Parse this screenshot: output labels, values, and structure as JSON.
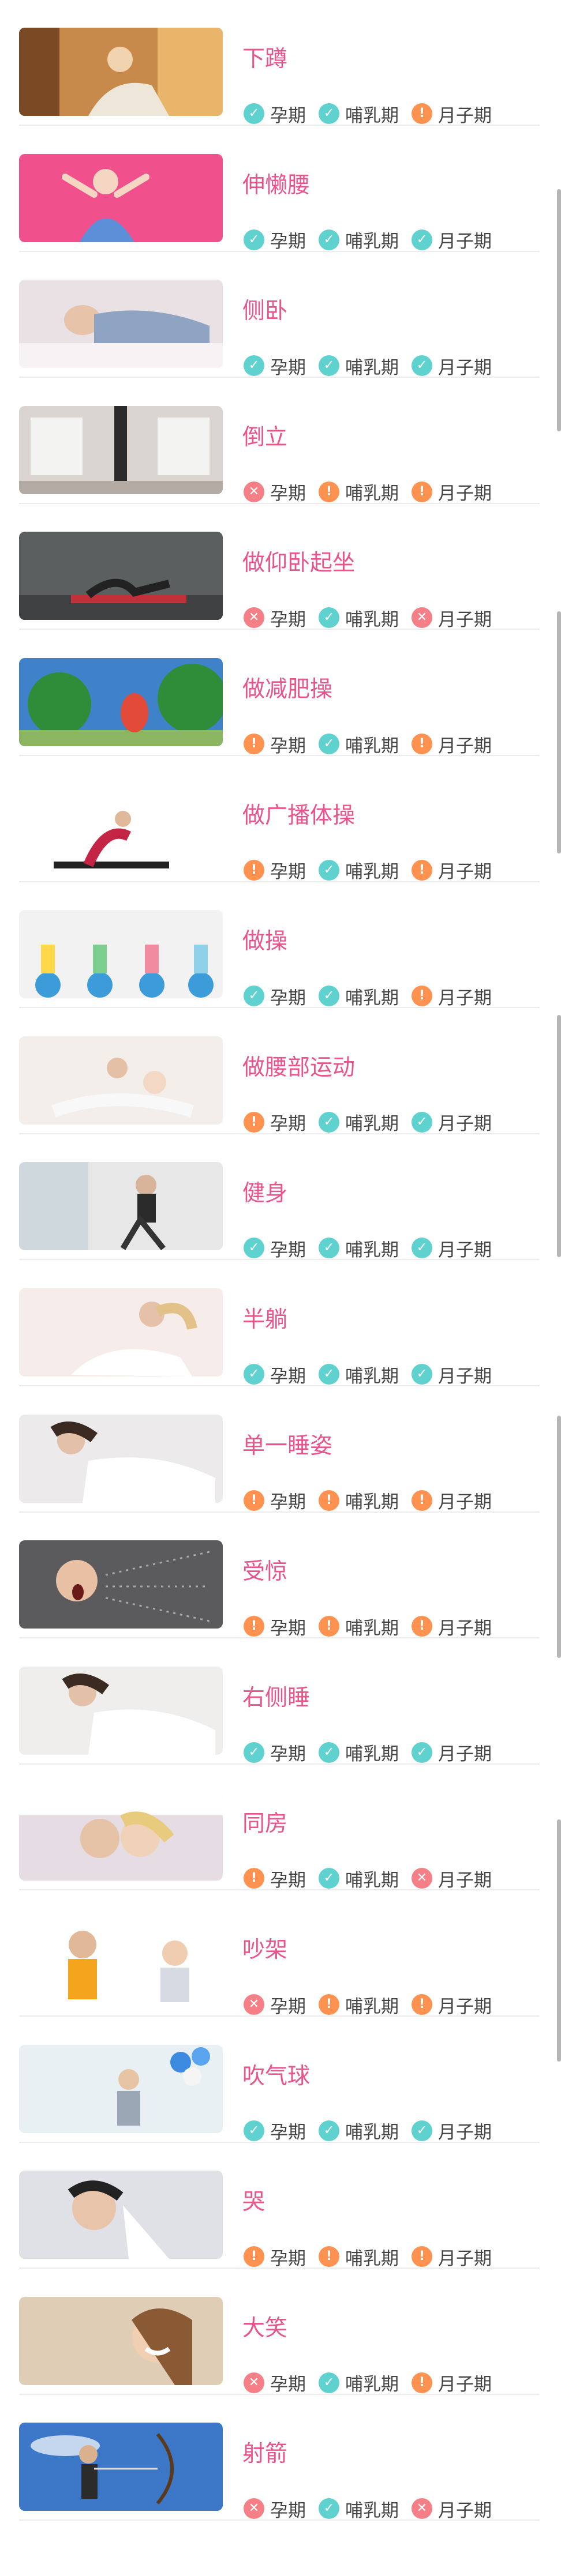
{
  "colors": {
    "title": "#e8558c",
    "ok": "#5fd1cf",
    "warn": "#ff9250",
    "no": "#f47f86"
  },
  "status_icons": {
    "ok": "✓",
    "warn": "!",
    "no": "✕"
  },
  "tag_labels": [
    "孕期",
    "哺乳期",
    "月子期"
  ],
  "items": [
    {
      "title": "下蹲",
      "statuses": [
        "ok",
        "ok",
        "warn"
      ],
      "thumb": "warm-room"
    },
    {
      "title": "伸懒腰",
      "statuses": [
        "ok",
        "ok",
        "ok"
      ],
      "thumb": "pink-stretch"
    },
    {
      "title": "侧卧",
      "statuses": [
        "ok",
        "ok",
        "ok"
      ],
      "thumb": "side-lying"
    },
    {
      "title": "倒立",
      "statuses": [
        "no",
        "warn",
        "warn"
      ],
      "thumb": "handstand"
    },
    {
      "title": "做仰卧起坐",
      "statuses": [
        "no",
        "ok",
        "no"
      ],
      "thumb": "situp"
    },
    {
      "title": "做减肥操",
      "statuses": [
        "warn",
        "ok",
        "warn"
      ],
      "thumb": "outdoor"
    },
    {
      "title": "做广播体操",
      "statuses": [
        "warn",
        "ok",
        "warn"
      ],
      "thumb": "yoga"
    },
    {
      "title": "做操",
      "statuses": [
        "ok",
        "ok",
        "warn"
      ],
      "thumb": "ball-class"
    },
    {
      "title": "做腰部运动",
      "statuses": [
        "warn",
        "ok",
        "ok"
      ],
      "thumb": "mom-baby"
    },
    {
      "title": "健身",
      "statuses": [
        "ok",
        "ok",
        "ok"
      ],
      "thumb": "gym"
    },
    {
      "title": "半躺",
      "statuses": [
        "ok",
        "ok",
        "ok"
      ],
      "thumb": "half-lying"
    },
    {
      "title": "单一睡姿",
      "statuses": [
        "warn",
        "warn",
        "warn"
      ],
      "thumb": "sleeping"
    },
    {
      "title": "受惊",
      "statuses": [
        "warn",
        "warn",
        "warn"
      ],
      "thumb": "scream"
    },
    {
      "title": "右侧睡",
      "statuses": [
        "ok",
        "ok",
        "ok"
      ],
      "thumb": "right-side"
    },
    {
      "title": "同房",
      "statuses": [
        "warn",
        "ok",
        "no"
      ],
      "thumb": "couple"
    },
    {
      "title": "吵架",
      "statuses": [
        "no",
        "warn",
        "warn"
      ],
      "thumb": "argue"
    },
    {
      "title": "吹气球",
      "statuses": [
        "ok",
        "ok",
        "ok"
      ],
      "thumb": "balloons"
    },
    {
      "title": "哭",
      "statuses": [
        "warn",
        "warn",
        "warn"
      ],
      "thumb": "cry"
    },
    {
      "title": "大笑",
      "statuses": [
        "no",
        "ok",
        "warn"
      ],
      "thumb": "laugh"
    },
    {
      "title": "射箭",
      "statuses": [
        "no",
        "ok",
        "no"
      ],
      "thumb": "archery"
    }
  ]
}
